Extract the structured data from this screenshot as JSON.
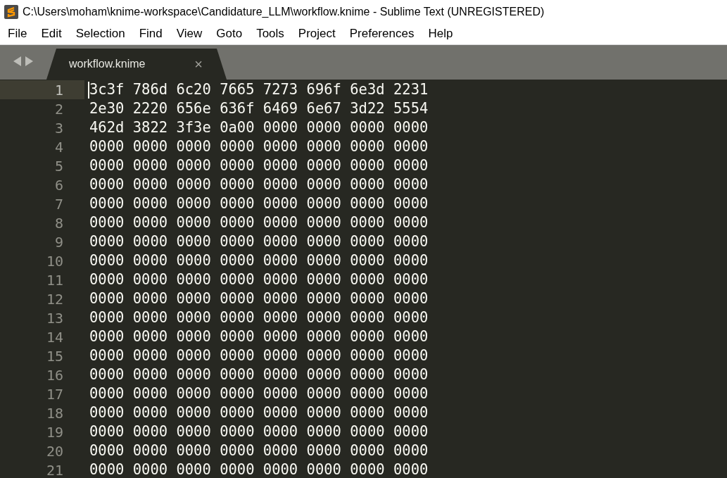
{
  "window": {
    "title": "C:\\Users\\moham\\knime-workspace\\Candidature_LLM\\workflow.knime - Sublime Text (UNREGISTERED)"
  },
  "menu": [
    "File",
    "Edit",
    "Selection",
    "Find",
    "View",
    "Goto",
    "Tools",
    "Project",
    "Preferences",
    "Help"
  ],
  "tabs": [
    {
      "label": "workflow.knime",
      "selected": true,
      "close": "×"
    }
  ],
  "lines": [
    {
      "number": "1",
      "text": "3c3f 786d 6c20 7665 7273 696f 6e3d 2231",
      "current": true
    },
    {
      "number": "2",
      "text": "2e30 2220 656e 636f 6469 6e67 3d22 5554",
      "current": false
    },
    {
      "number": "3",
      "text": "462d 3822 3f3e 0a00 0000 0000 0000 0000",
      "current": false
    },
    {
      "number": "4",
      "text": "0000 0000 0000 0000 0000 0000 0000 0000",
      "current": false
    },
    {
      "number": "5",
      "text": "0000 0000 0000 0000 0000 0000 0000 0000",
      "current": false
    },
    {
      "number": "6",
      "text": "0000 0000 0000 0000 0000 0000 0000 0000",
      "current": false
    },
    {
      "number": "7",
      "text": "0000 0000 0000 0000 0000 0000 0000 0000",
      "current": false
    },
    {
      "number": "8",
      "text": "0000 0000 0000 0000 0000 0000 0000 0000",
      "current": false
    },
    {
      "number": "9",
      "text": "0000 0000 0000 0000 0000 0000 0000 0000",
      "current": false
    },
    {
      "number": "10",
      "text": "0000 0000 0000 0000 0000 0000 0000 0000",
      "current": false
    },
    {
      "number": "11",
      "text": "0000 0000 0000 0000 0000 0000 0000 0000",
      "current": false
    },
    {
      "number": "12",
      "text": "0000 0000 0000 0000 0000 0000 0000 0000",
      "current": false
    },
    {
      "number": "13",
      "text": "0000 0000 0000 0000 0000 0000 0000 0000",
      "current": false
    },
    {
      "number": "14",
      "text": "0000 0000 0000 0000 0000 0000 0000 0000",
      "current": false
    },
    {
      "number": "15",
      "text": "0000 0000 0000 0000 0000 0000 0000 0000",
      "current": false
    },
    {
      "number": "16",
      "text": "0000 0000 0000 0000 0000 0000 0000 0000",
      "current": false
    },
    {
      "number": "17",
      "text": "0000 0000 0000 0000 0000 0000 0000 0000",
      "current": false
    },
    {
      "number": "18",
      "text": "0000 0000 0000 0000 0000 0000 0000 0000",
      "current": false
    },
    {
      "number": "19",
      "text": "0000 0000 0000 0000 0000 0000 0000 0000",
      "current": false
    },
    {
      "number": "20",
      "text": "0000 0000 0000 0000 0000 0000 0000 0000",
      "current": false
    },
    {
      "number": "21",
      "text": "0000 0000 0000 0000 0000 0000 0000 0000",
      "current": false
    }
  ]
}
